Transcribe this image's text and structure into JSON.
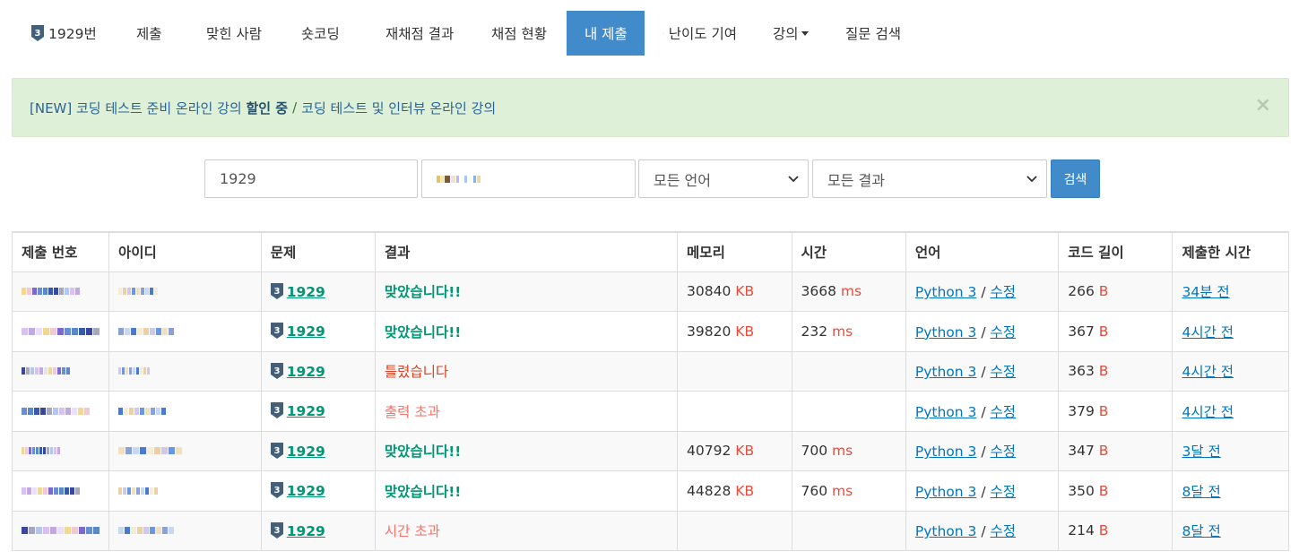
{
  "nav": {
    "items": [
      {
        "label": "1929번",
        "icon": "tier-badge-icon",
        "width": 117
      },
      {
        "label": "제출",
        "width": 78
      },
      {
        "label": "맞힌 사람",
        "width": 106
      },
      {
        "label": "숏코딩",
        "width": 94
      },
      {
        "label": "재채점 결과",
        "width": 118
      },
      {
        "label": "채점 현황",
        "width": 104
      },
      {
        "label": "내 제출",
        "width": 87,
        "active": true
      },
      {
        "label": "난이도 기여",
        "icon": "external-link-icon",
        "width": 123
      },
      {
        "label": "강의",
        "dropdown": true,
        "width": 81
      },
      {
        "label": "질문 검색",
        "width": 103
      }
    ],
    "tier_badge_text": "3"
  },
  "alert": {
    "prefix_link": "[NEW] 코딩 테스트 준비 온라인 강의",
    "highlight": "할인 중",
    "separator": "/",
    "second_link": "코딩 테스트 및 인터뷰 온라인 강의",
    "close": "×"
  },
  "search": {
    "problem_value": "1929",
    "language_selected": "모든 언어",
    "result_selected": "모든 결과",
    "button_label": "검색"
  },
  "table": {
    "headers": [
      "제출 번호",
      "아이디",
      "문제",
      "결과",
      "메모리",
      "시간",
      "언어",
      "코드 길이",
      "제출한 시간"
    ],
    "rows": [
      {
        "problem": "1929",
        "result": "맞았습니다!!",
        "result_type": "ac",
        "memory": "30840",
        "memory_unit": "KB",
        "time": "3668",
        "time_unit": "ms",
        "language": "Python 3",
        "edit": "수정",
        "code_length": "266",
        "code_unit": "B",
        "submitted": "34분 전"
      },
      {
        "problem": "1929",
        "result": "맞았습니다!!",
        "result_type": "ac",
        "memory": "39820",
        "memory_unit": "KB",
        "time": "232",
        "time_unit": "ms",
        "language": "Python 3",
        "edit": "수정",
        "code_length": "367",
        "code_unit": "B",
        "submitted": "4시간 전"
      },
      {
        "problem": "1929",
        "result": "틀렸습니다",
        "result_type": "wa",
        "memory": "",
        "memory_unit": "",
        "time": "",
        "time_unit": "",
        "language": "Python 3",
        "edit": "수정",
        "code_length": "363",
        "code_unit": "B",
        "submitted": "4시간 전"
      },
      {
        "problem": "1929",
        "result": "출력 초과",
        "result_type": "ole",
        "memory": "",
        "memory_unit": "",
        "time": "",
        "time_unit": "",
        "language": "Python 3",
        "edit": "수정",
        "code_length": "379",
        "code_unit": "B",
        "submitted": "4시간 전"
      },
      {
        "problem": "1929",
        "result": "맞았습니다!!",
        "result_type": "ac",
        "memory": "40792",
        "memory_unit": "KB",
        "time": "700",
        "time_unit": "ms",
        "language": "Python 3",
        "edit": "수정",
        "code_length": "347",
        "code_unit": "B",
        "submitted": "3달 전"
      },
      {
        "problem": "1929",
        "result": "맞았습니다!!",
        "result_type": "ac",
        "memory": "44828",
        "memory_unit": "KB",
        "time": "760",
        "time_unit": "ms",
        "language": "Python 3",
        "edit": "수정",
        "code_length": "350",
        "code_unit": "B",
        "submitted": "8달 전"
      },
      {
        "problem": "1929",
        "result": "시간 초과",
        "result_type": "tle",
        "memory": "",
        "memory_unit": "",
        "time": "",
        "time_unit": "",
        "language": "Python 3",
        "edit": "수정",
        "code_length": "214",
        "code_unit": "B",
        "submitted": "8달 전"
      }
    ]
  },
  "colors": {
    "primary": "#428bca",
    "accepted": "#009874",
    "wrong": "#dd4124",
    "warning": "#fa7268",
    "link": "#0076c0",
    "unit": "#e74c3c",
    "alert_bg": "#dff0d8"
  }
}
